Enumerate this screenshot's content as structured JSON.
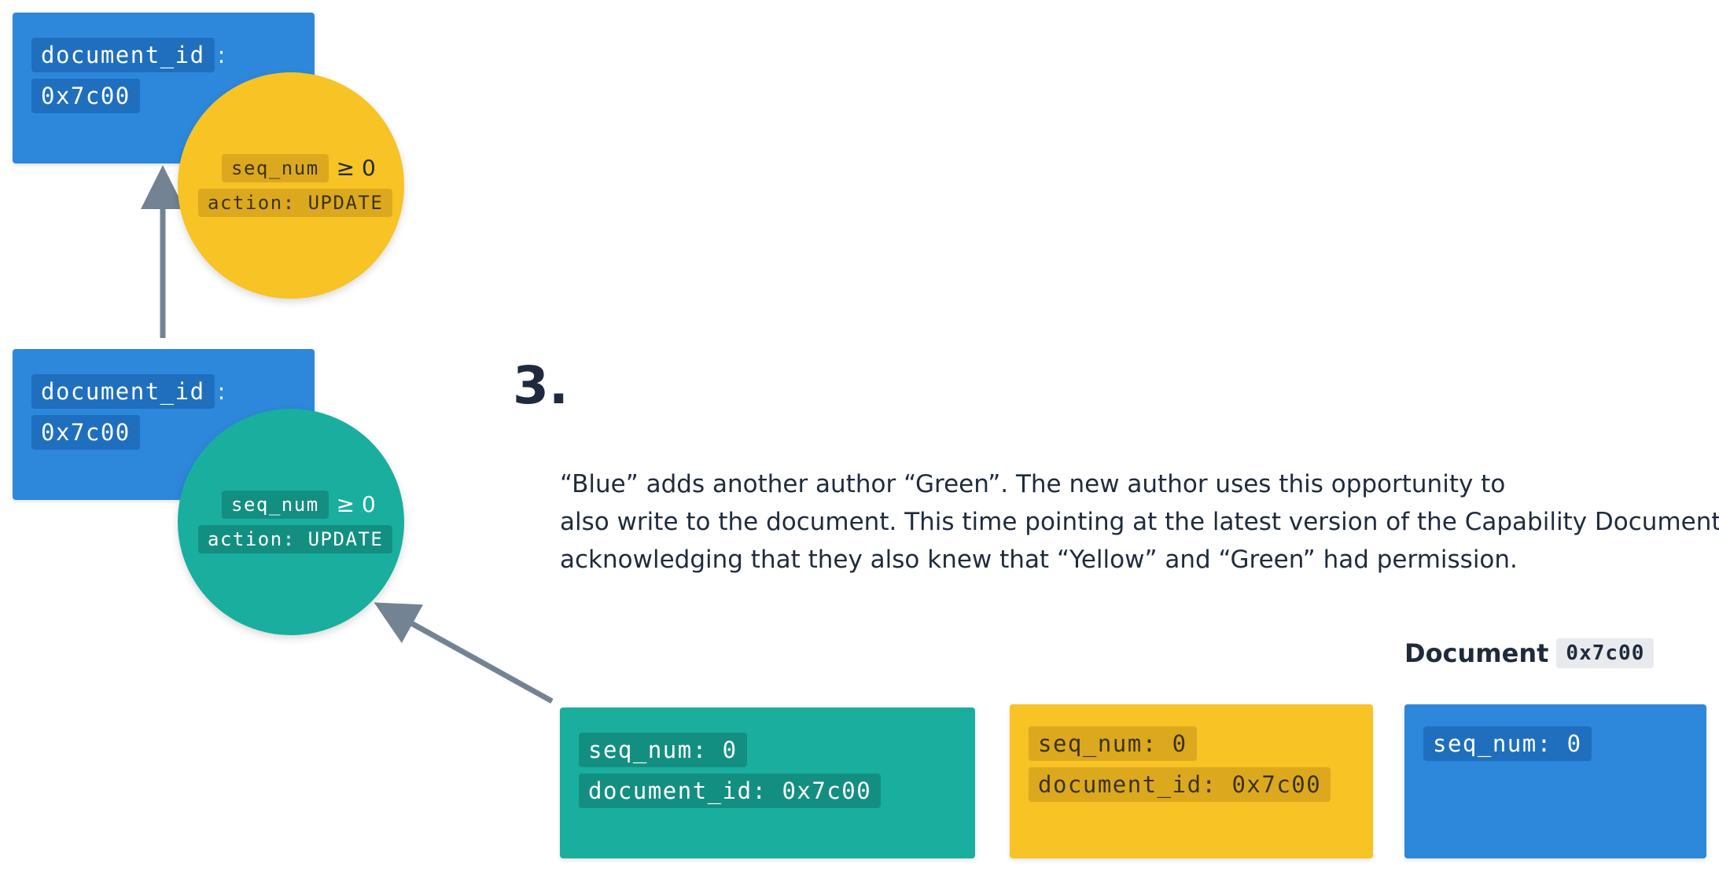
{
  "top_node": {
    "doc_field": "document_id",
    "colon": ":",
    "doc_value": "0x7c00",
    "seq_field": "seq_num",
    "seq_cond": "≥ 0",
    "action": "action: UPDATE"
  },
  "middle_node": {
    "doc_field": "document_id",
    "colon": ":",
    "doc_value": "0x7c00",
    "seq_field": "seq_num",
    "seq_cond": "≥ 0",
    "action": "action: UPDATE"
  },
  "step_number": "3.",
  "description": [
    "“Blue” adds another author “Green”. The new author uses this opportunity to",
    "also write to the document. This time pointing at the latest version of the Capability Document,",
    "acknowledging that they also knew that “Yellow” and “Green” had permission."
  ],
  "bottom_cards": {
    "green": {
      "seq": "seq_num: 0",
      "doc": "document_id: 0x7c00"
    },
    "yellow": {
      "seq": "seq_num: 0",
      "doc": "document_id: 0x7c00"
    },
    "blue": {
      "seq": "seq_num: 0"
    }
  },
  "document_header": {
    "label": "Document",
    "id": "0x7c00"
  },
  "colors": {
    "blue": "#2d88db",
    "teal": "#1aae9f",
    "yellow": "#f7c325",
    "arrow": "#738394",
    "text": "#1f2b3d"
  }
}
